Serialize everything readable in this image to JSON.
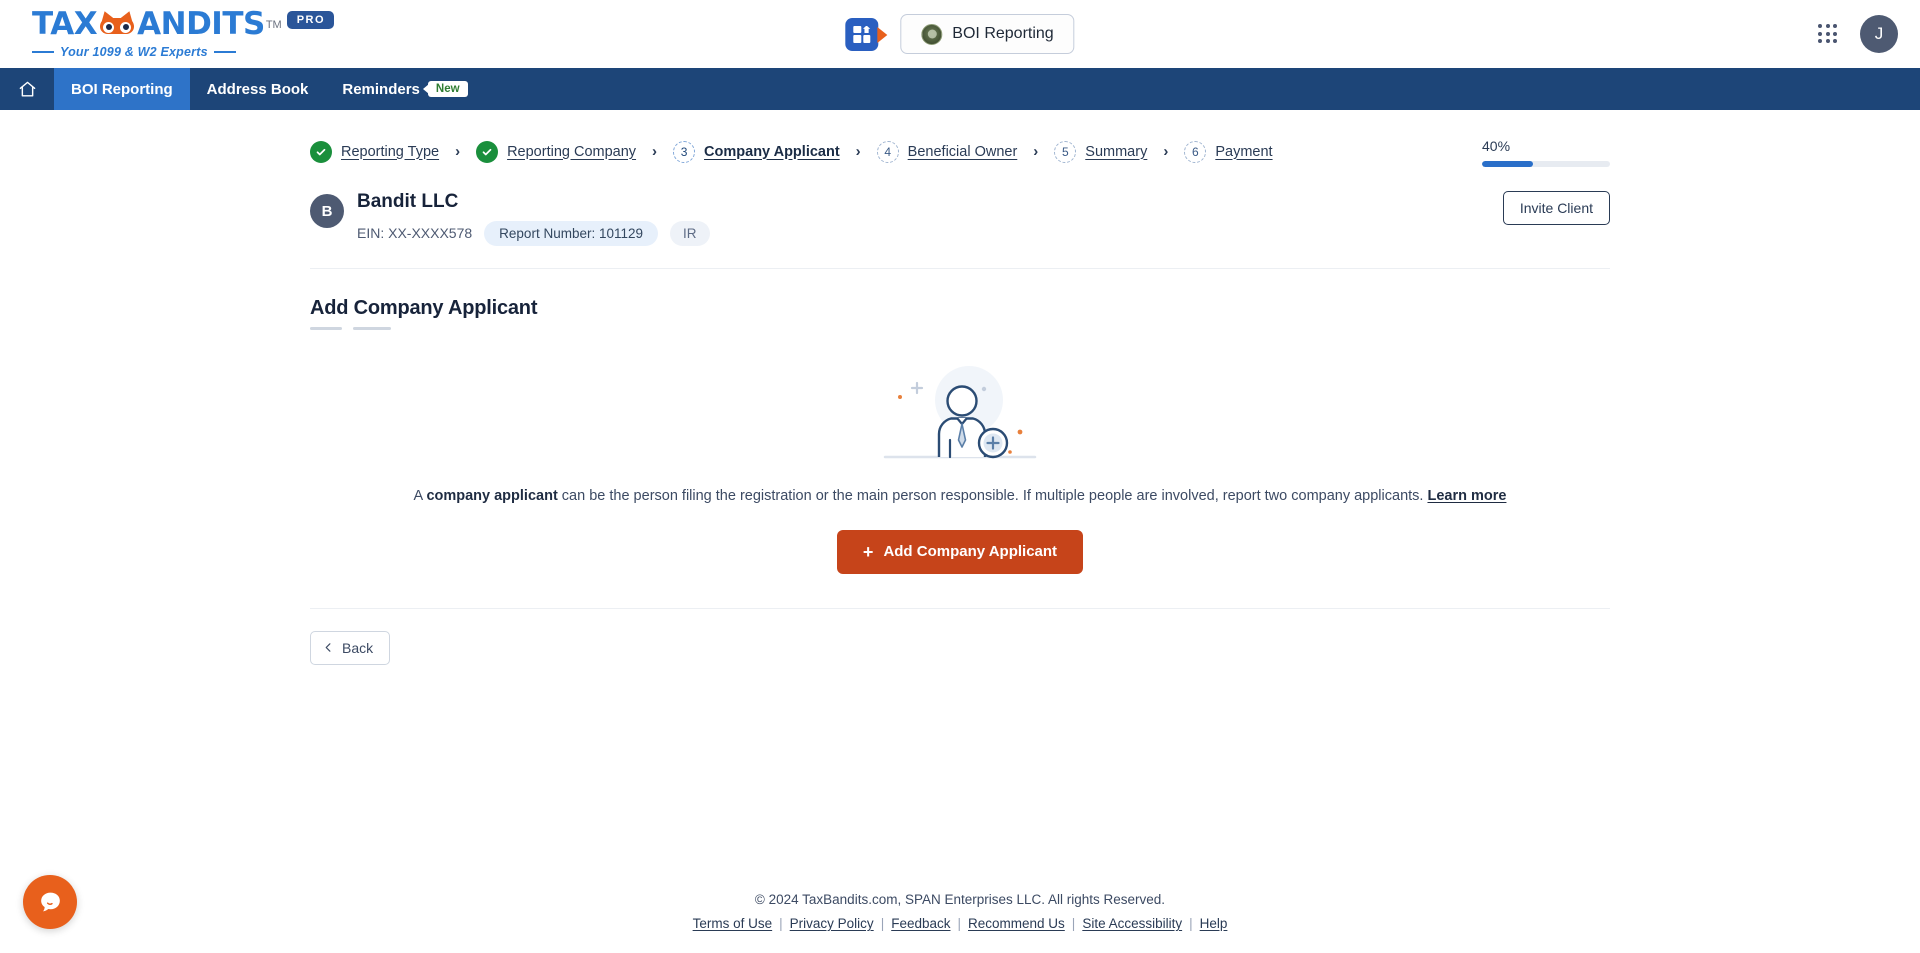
{
  "brand": {
    "logo_main_pre": "TAX",
    "logo_main_post": "ANDITS",
    "trademark": "TM",
    "tagline": "Your 1099 & W2 Experts",
    "pro_badge": "PRO"
  },
  "header": {
    "app_switcher_icon": "app-tile-icon",
    "boi_button_label": "BOI Reporting",
    "boi_seal_icon": "government-seal-icon",
    "grid_icon": "apps-grid-icon",
    "avatar_initial": "J"
  },
  "nav": {
    "home_icon": "home-icon",
    "items": [
      {
        "label": "BOI Reporting",
        "active": true,
        "badge": null
      },
      {
        "label": "Address Book",
        "active": false,
        "badge": null
      },
      {
        "label": "Reminders",
        "active": false,
        "badge": "New"
      }
    ]
  },
  "stepper": {
    "steps": [
      {
        "number": "1",
        "label": "Reporting Type",
        "state": "done"
      },
      {
        "number": "2",
        "label": "Reporting Company",
        "state": "done"
      },
      {
        "number": "3",
        "label": "Company Applicant",
        "state": "current"
      },
      {
        "number": "4",
        "label": "Beneficial Owner",
        "state": "upcoming"
      },
      {
        "number": "5",
        "label": "Summary",
        "state": "upcoming"
      },
      {
        "number": "6",
        "label": "Payment",
        "state": "upcoming"
      }
    ],
    "chevron": "›",
    "progress_label": "40%",
    "progress_value": 40,
    "progress_color": "#2a6fc9"
  },
  "company": {
    "avatar_initial": "B",
    "name": "Bandit LLC",
    "ein": "EIN: XX-XXXX578",
    "report_number": "Report Number: 101129",
    "status_badge": "IR",
    "invite_button": "Invite Client"
  },
  "section": {
    "title": "Add Company Applicant"
  },
  "empty_state": {
    "illustration_icon": "person-add-illustration",
    "desc_prefix": "A ",
    "desc_bold": "company applicant",
    "desc_rest": " can be the person filing the registration or the main person responsible. If multiple people are involved, report two company applicants. ",
    "learn_more": "Learn more",
    "add_button": "Add Company Applicant",
    "add_button_plus": "+",
    "add_button_color": "#c6441a"
  },
  "back": {
    "label": "Back",
    "icon": "chevron-left-icon"
  },
  "footer": {
    "copyright": "© 2024 TaxBandits.com, SPAN Enterprises LLC. All rights Reserved.",
    "links": [
      "Terms of Use",
      "Privacy Policy",
      "Feedback",
      "Recommend Us",
      " Site Accessibility",
      "Help"
    ],
    "separator": "|"
  },
  "chat": {
    "icon": "chat-bubble-icon",
    "color": "#e8601c"
  }
}
